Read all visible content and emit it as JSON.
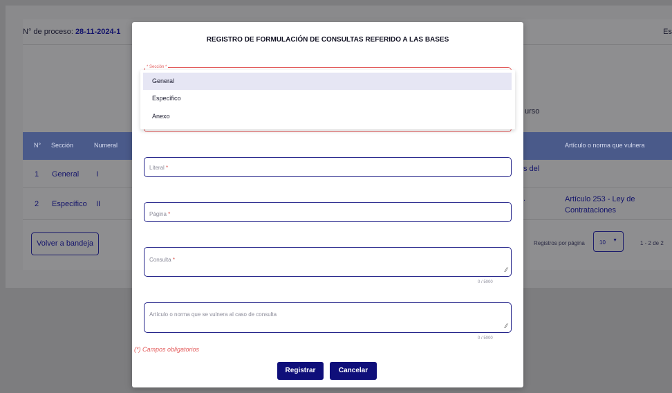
{
  "background": {
    "process_label": "N° de proceso: ",
    "process_value": "28-11-2024-1",
    "right_cut_text": "Es",
    "curso_text": "urso",
    "table": {
      "headers": [
        "N°",
        "Sección",
        "Numeral",
        "Artículo o norma que vulnera"
      ],
      "rows": [
        {
          "n": "1",
          "seccion": "General",
          "numeral": "I",
          "frag": "s del",
          "articulo": ""
        },
        {
          "n": "2",
          "seccion": "Específico",
          "numeral": "II",
          "frag": ".",
          "articulo": "Artículo 253 - Ley de Contrataciones"
        }
      ]
    },
    "volver_label": "Volver a bandeja",
    "registros_label": "Registros por página",
    "page_size": "10",
    "pagination": "1 - 2 de 2"
  },
  "modal": {
    "title": "REGISTRO DE FORMULACIÓN DE CONSULTAS REFERIDO A LAS BASES",
    "seccion_label": "Sección",
    "dropdown_options": [
      "General",
      "Específico",
      "Anexo"
    ],
    "literal_placeholder": "Literal",
    "pagina_placeholder": "Página",
    "consulta_placeholder": "Consulta",
    "consulta_counter": "0 / 5000",
    "articulo_placeholder": "Artículo o norma que se vulnera al caso de consulta",
    "articulo_counter": "0 / 5000",
    "mandatory_note": "(*) Campos obligatorios",
    "register_label": "Registrar",
    "cancel_label": "Cancelar",
    "required_mark": "*"
  },
  "colors": {
    "primary": "#0f0f7a",
    "error": "#e35b5b",
    "overlay": "#7d7d7f"
  }
}
